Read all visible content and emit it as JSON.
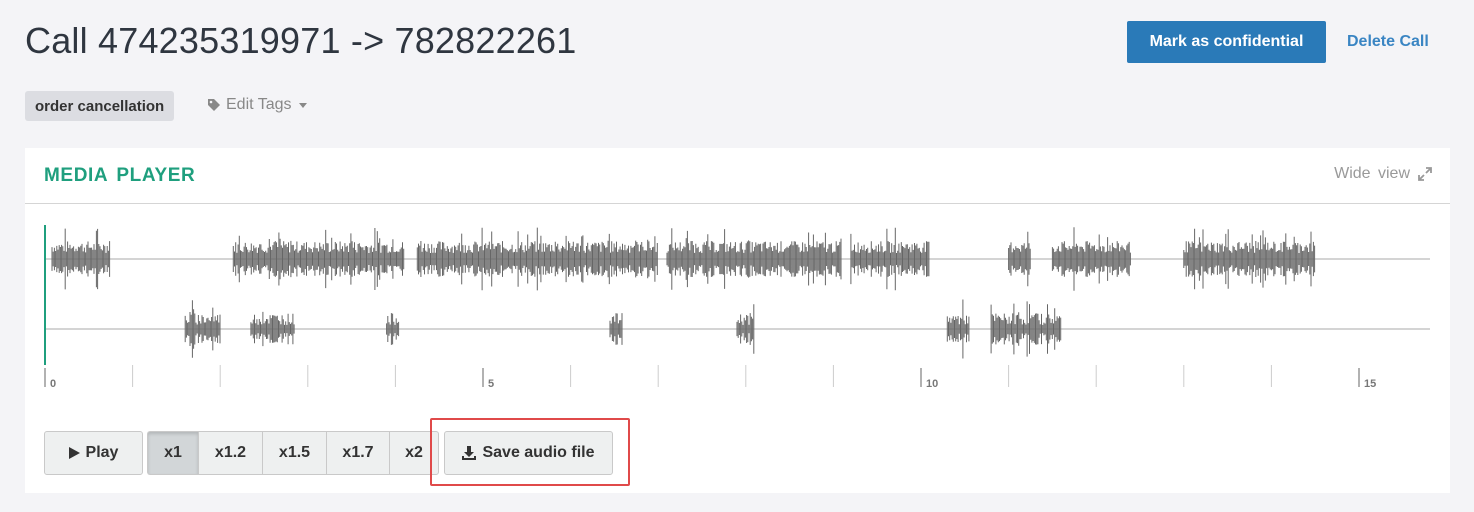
{
  "header": {
    "title": "Call 474235319971 -> 782822261",
    "mark_confidential_label": "Mark as confidential",
    "delete_call_label": "Delete Call"
  },
  "tags": {
    "items": [
      "order cancellation"
    ],
    "edit_label": "Edit Tags",
    "edit_icon": "tag-icon"
  },
  "media_player": {
    "title": "MEDIA PLAYER",
    "wide_view_label": "Wide view",
    "wide_view_icon": "expand-icon",
    "timeline": {
      "major_ticks": [
        "0",
        "5",
        "10",
        "15"
      ],
      "max_seconds": 15.8,
      "playhead_seconds": 0
    },
    "colors": {
      "accent": "#1f9f7e",
      "waveform": "#666666",
      "primary": "#2a7ab8",
      "highlight": "#e04a4a"
    },
    "channels": [
      {
        "name": "channel-1",
        "segments": [
          [
            0.08,
            0.75
          ],
          [
            2.15,
            4.1
          ],
          [
            4.25,
            7.0
          ],
          [
            7.1,
            9.1
          ],
          [
            9.2,
            10.1
          ],
          [
            11.0,
            11.25
          ],
          [
            11.5,
            12.4
          ],
          [
            13.0,
            14.5
          ]
        ]
      },
      {
        "name": "channel-2",
        "segments": [
          [
            1.6,
            2.0
          ],
          [
            2.35,
            2.85
          ],
          [
            3.9,
            4.05
          ],
          [
            6.45,
            6.6
          ],
          [
            7.9,
            8.1
          ],
          [
            10.3,
            10.55
          ],
          [
            10.8,
            11.6
          ]
        ]
      }
    ],
    "play_label": "Play",
    "speeds": [
      "x1",
      "x1.2",
      "x1.5",
      "x1.7",
      "x2"
    ],
    "active_speed": "x1",
    "save_audio_label": "Save audio file"
  }
}
